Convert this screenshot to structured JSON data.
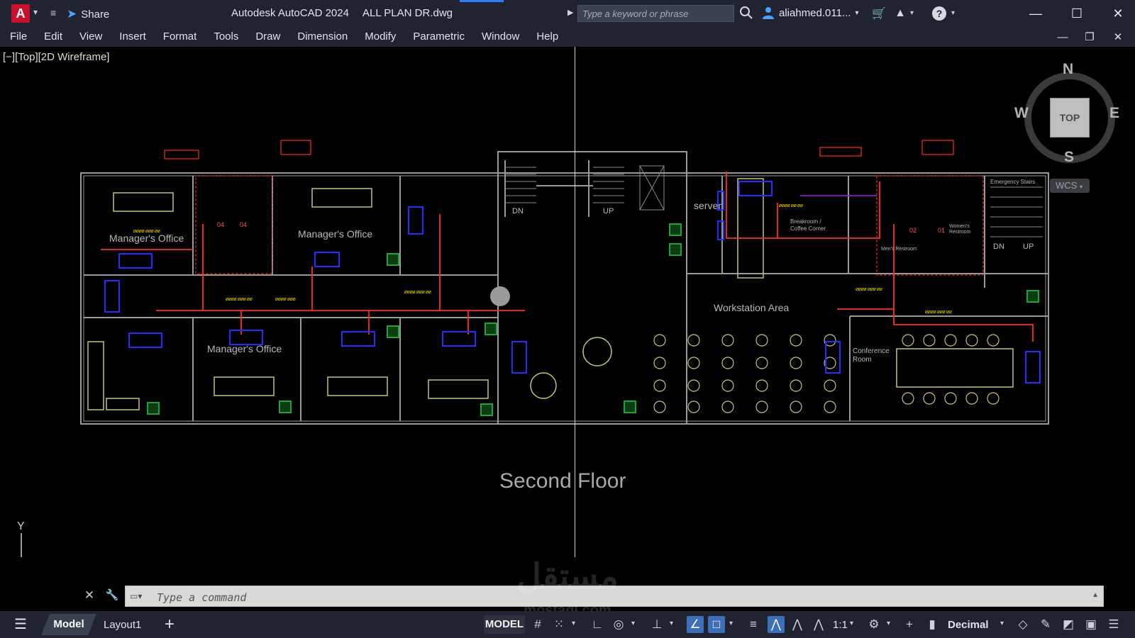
{
  "titlebar": {
    "logo": "A",
    "share_label": "Share",
    "app_title": "Autodesk AutoCAD 2024",
    "file_name": "ALL PLAN DR.dwg",
    "search_placeholder": "Type a keyword or phrase",
    "user_name": "aliahmed.011..."
  },
  "menu": {
    "items": [
      "File",
      "Edit",
      "View",
      "Insert",
      "Format",
      "Tools",
      "Draw",
      "Dimension",
      "Modify",
      "Parametric",
      "Window",
      "Help"
    ]
  },
  "viewport": {
    "view_label": "[−][Top][2D Wireframe]",
    "floor_title": "Second Floor",
    "rooms": [
      "Manager's Office",
      "Manager's Office",
      "Manager's Office",
      "server",
      "Breakroom / Coffee Corner",
      "Workstation Area",
      "Conference Room",
      "Emergency Stairs",
      "Women's Restroom",
      "Men's Restroom"
    ],
    "stair_labels": [
      "DN",
      "UP",
      "DN",
      "UP"
    ],
    "restroom_numbers": [
      "04",
      "04",
      "02",
      "01"
    ]
  },
  "viewcube": {
    "north": "N",
    "south": "S",
    "east": "E",
    "west": "W",
    "face": "TOP",
    "wcs": "WCS"
  },
  "ucs": {
    "y_label": "Y"
  },
  "command": {
    "placeholder": "Type a command"
  },
  "watermark": {
    "arabic": "مستقل",
    "site": "mostaql.com"
  },
  "statusbar": {
    "tab_model": "Model",
    "tab_layout": "Layout1",
    "model_button": "MODEL",
    "scale": "1:1",
    "units": "Decimal"
  },
  "colors": {
    "titlebar_bg": "#1f2430",
    "canvas_bg": "#000000",
    "wall": "#9a9a9a",
    "furniture": "#c9c27a",
    "duct": "#ff2a2a",
    "equipment": "#2a2aff",
    "green_unit": "#1fa33a",
    "annotation": "#ffe600",
    "accent": "#2d7ff9"
  }
}
